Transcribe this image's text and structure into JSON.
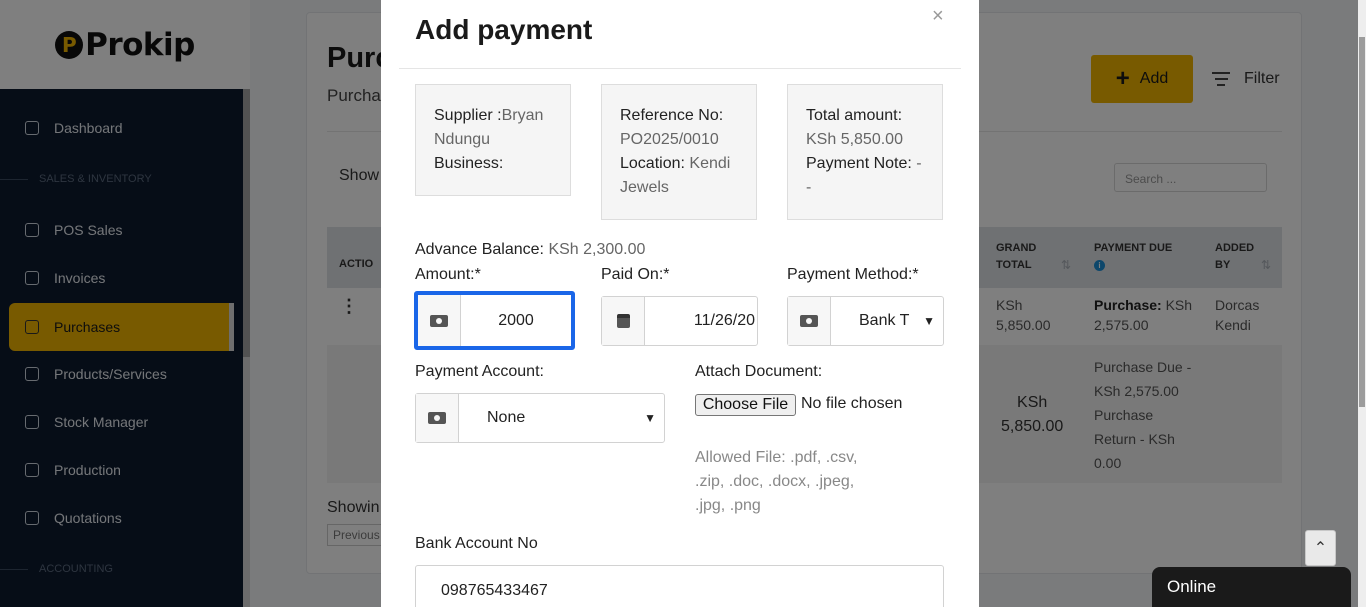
{
  "sidebar": {
    "logo": "Prokip",
    "items": {
      "dashboard": "Dashboard",
      "section_sales": "SALES & INVENTORY",
      "pos_sales": "POS Sales",
      "invoices": "Invoices",
      "purchases": "Purchases",
      "products": "Products/Services",
      "stock": "Stock Manager",
      "production": "Production",
      "quotations": "Quotations",
      "section_accounting": "ACCOUNTING"
    }
  },
  "page": {
    "title": "Purc",
    "subtitle": "Purcha",
    "add_label": "Add",
    "filter_label": "Filter",
    "show_label": "Show",
    "search_placeholder": "Search ...",
    "showing_label": "Showin",
    "previous_label": "Previous",
    "table": {
      "headers": {
        "action": "ACTIO",
        "grand_total_1": "GRAND",
        "grand_total_2": "TOTAL",
        "payment_due": "PAYMENT DUE",
        "added_by_1": "ADDED",
        "added_by_2": "BY"
      },
      "row": {
        "grand_total_1": "KSh",
        "grand_total_2": "5,850.00",
        "payment_due_label": "Purchase:",
        "payment_due_1": "KSh",
        "payment_due_2": "2,575.00",
        "added_by_1": "Dorcas",
        "added_by_2": "Kendi"
      },
      "footer": {
        "total_1": "KSh",
        "total_2": "5,850.00",
        "due_1": "Purchase Due -",
        "due_2": "KSh 2,575.00",
        "due_3": "Purchase",
        "due_4": "Return - KSh",
        "due_5": "0.00"
      }
    }
  },
  "modal": {
    "title": "Add payment",
    "close": "×",
    "supplier_label": "Supplier :",
    "supplier_value_1": "Bryan",
    "supplier_value_2": "Ndungu",
    "business_label": "Business:",
    "reference_label": "Reference No:",
    "reference_value": "PO2025/0010",
    "location_label": "Location:",
    "location_value_1": "Kendi",
    "location_value_2": "Jewels",
    "total_label": "Total amount:",
    "total_value": "KSh 5,850.00",
    "payment_note_label": "Payment Note:",
    "payment_note_value_1": "-",
    "payment_note_value_2": "-",
    "advance_label": "Advance Balance:",
    "advance_value": "KSh 2,300.00",
    "amount_label": "Amount:*",
    "amount_value": "2000",
    "paid_on_label": "Paid On:*",
    "paid_on_value": "11/26/20",
    "method_label": "Payment Method:*",
    "method_value": "Bank T",
    "account_label": "Payment Account:",
    "account_value": "None",
    "attach_label": "Attach Document:",
    "choose_file": "Choose File",
    "no_file": "No file chosen",
    "allowed_1": "Allowed File: .pdf, .csv,",
    "allowed_2": ".zip, .doc, .docx, .jpeg,",
    "allowed_3": ".jpg, .png",
    "bank_label": "Bank Account No",
    "bank_value": "098765433467"
  },
  "widgets": {
    "online": "Online"
  },
  "icons": [
    "home-icon",
    "bag-icon",
    "invoice-icon",
    "purchases-icon",
    "box-icon",
    "stock-icon",
    "factory-icon",
    "quote-icon",
    "plus-icon",
    "filter-icon",
    "money-icon",
    "calendar-icon",
    "chevron-down-icon",
    "chevron-up-icon",
    "close-icon",
    "info-icon",
    "sort-icon"
  ],
  "colors": {
    "sidebar_bg": "#0d1b2e",
    "accent": "#f0b400",
    "focus_border": "#1a66e8"
  }
}
